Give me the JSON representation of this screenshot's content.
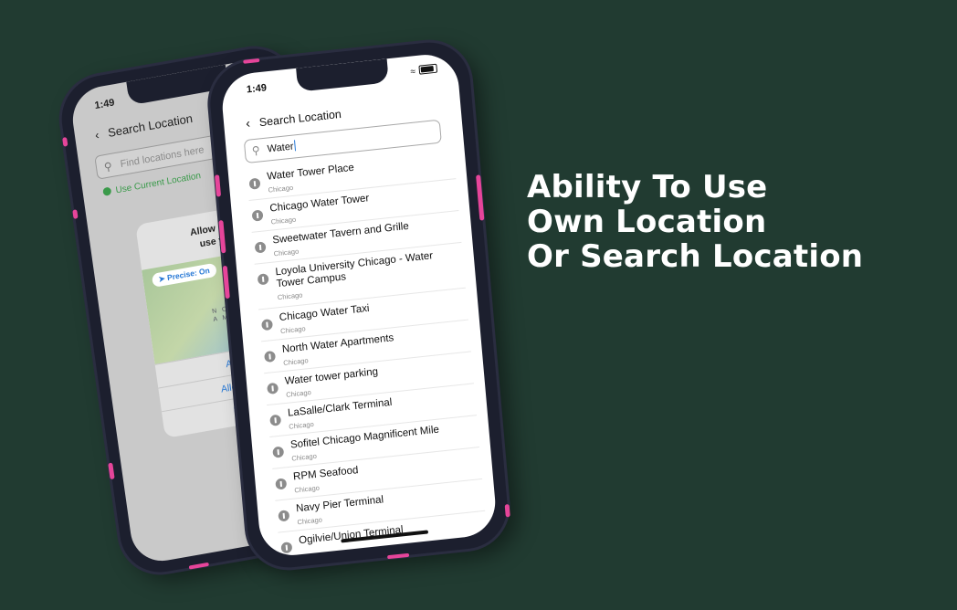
{
  "headline": [
    "Ability To Use",
    "Own Location",
    "Or Search Location"
  ],
  "colors": {
    "background": "#213b31",
    "accent": "#e6459a",
    "link": "#2a7ad6",
    "success": "#3a9a4a"
  },
  "back_phone": {
    "time": "1:49",
    "title": "Search Location",
    "search_placeholder": "Find locations here",
    "use_current_location": "Use Current Location",
    "dialog": {
      "title_line1": "Allow “Locatio",
      "title_line2": "use your lo",
      "precise": "Precise: On",
      "map_label_1": "N O R",
      "map_label_2": "A M E R",
      "btn_allow_once": "Allow O",
      "btn_allow_while": "Allow While",
      "btn_dont_allow": "Don't A"
    }
  },
  "front_phone": {
    "time": "1:49",
    "title": "Search Location",
    "search_value": "Water",
    "results": [
      {
        "name": "Water Tower Place",
        "city": "Chicago"
      },
      {
        "name": "Chicago Water Tower",
        "city": "Chicago"
      },
      {
        "name": "Sweetwater Tavern and Grille",
        "city": "Chicago"
      },
      {
        "name": "Loyola University Chicago - Water Tower Campus",
        "city": "Chicago"
      },
      {
        "name": "Chicago Water Taxi",
        "city": "Chicago"
      },
      {
        "name": "North Water Apartments",
        "city": "Chicago"
      },
      {
        "name": "Water tower parking",
        "city": "Chicago"
      },
      {
        "name": "LaSalle/Clark Terminal",
        "city": "Chicago"
      },
      {
        "name": "Sofitel Chicago Magnificent Mile",
        "city": "Chicago"
      },
      {
        "name": "RPM Seafood",
        "city": "Chicago"
      },
      {
        "name": "Navy Pier Terminal",
        "city": "Chicago"
      },
      {
        "name": "Ogilvie/Union Terminal",
        "city": ""
      }
    ]
  }
}
